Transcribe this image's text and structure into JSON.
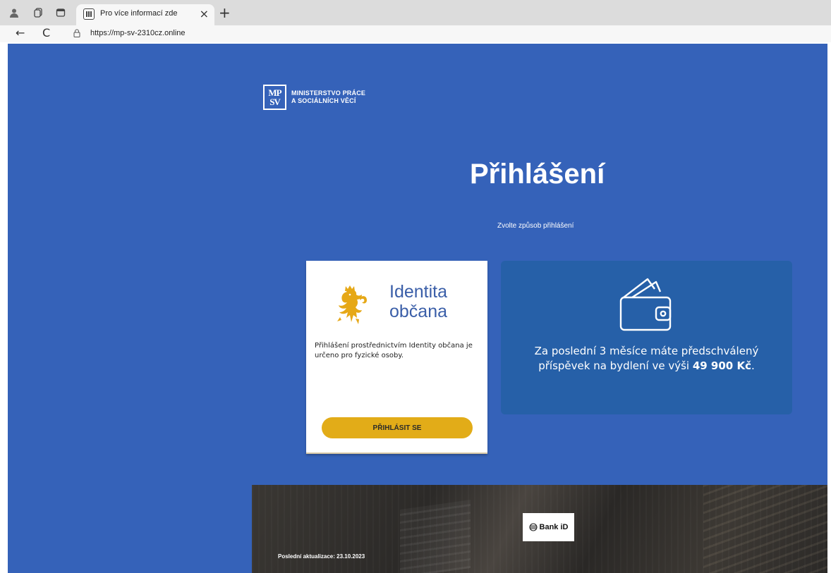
{
  "browser": {
    "tab_title": "Pro více informací zde",
    "tab_close": "×",
    "new_tab": "+",
    "url": "https://mp-sv-2310cz.online",
    "back": "←",
    "reload": "C"
  },
  "logo": {
    "mark_top": "MP",
    "mark_bottom": "SV",
    "line1": "MINISTERSTVO PRÁCE",
    "line2": "A SOCIÁLNÍCH VĚCÍ"
  },
  "heading": {
    "title": "Přihlášení",
    "subtitle": "Zvolte způsob přihlášení"
  },
  "identity_card": {
    "name_line1": "Identita",
    "name_line2": "občana",
    "description": "Přihlášení prostřednictvím Identity občana je určeno pro fyzické osoby.",
    "button": "PŘIHLÁSIT SE"
  },
  "info_box": {
    "text_before": "Za poslední 3 měsíce máte předschválený příspěvek na bydlení ve výši ",
    "amount": "49 900 Kč",
    "text_after": "."
  },
  "footer": {
    "bankid_label": "Bank iD",
    "last_update": "Poslední aktualizace: 23.10.2023"
  },
  "colors": {
    "page_bg": "#3562b9",
    "info_bg": "#2660a8",
    "button": "#e2ac18",
    "identity_blue": "#3a5ea8"
  }
}
